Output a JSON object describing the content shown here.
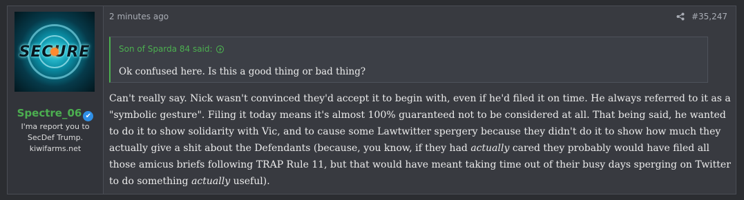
{
  "user": {
    "username": "Spectre_06",
    "title_lines": [
      "I'ma report you to",
      "SecDef Trump.",
      "kiwifarms.net"
    ],
    "avatar_text": "SECURE"
  },
  "post": {
    "time": "2 minutes ago",
    "post_number": "#35,247",
    "quote": {
      "author": "Son of Sparda 84 said:",
      "text": "Ok confused here. Is this a good thing or bad thing?"
    },
    "body": {
      "p1": "Can't really say. Nick wasn't convinced they'd accept it to begin with, even if he'd filed it on time. He always referred to it as a \"symbolic gesture\". Filing it today means it's almost 100% guaranteed not to be considered at all. That being said, he wanted to do it to show solidarity with Vic, and to cause some Lawtwitter spergery because they didn't do it to show how much they actually give a shit about the Defendants (because, you know, if they had ",
      "em1": "actually",
      "p2": " cared they probably would have filed all those amicus briefs following TRAP Rule 11, but that would have meant taking time out of their busy days sperging on Twitter to do something ",
      "em2": "actually",
      "p3": " useful)."
    }
  },
  "colors": {
    "accent_green": "#4caf50",
    "verified_blue": "#2f8fe6"
  }
}
